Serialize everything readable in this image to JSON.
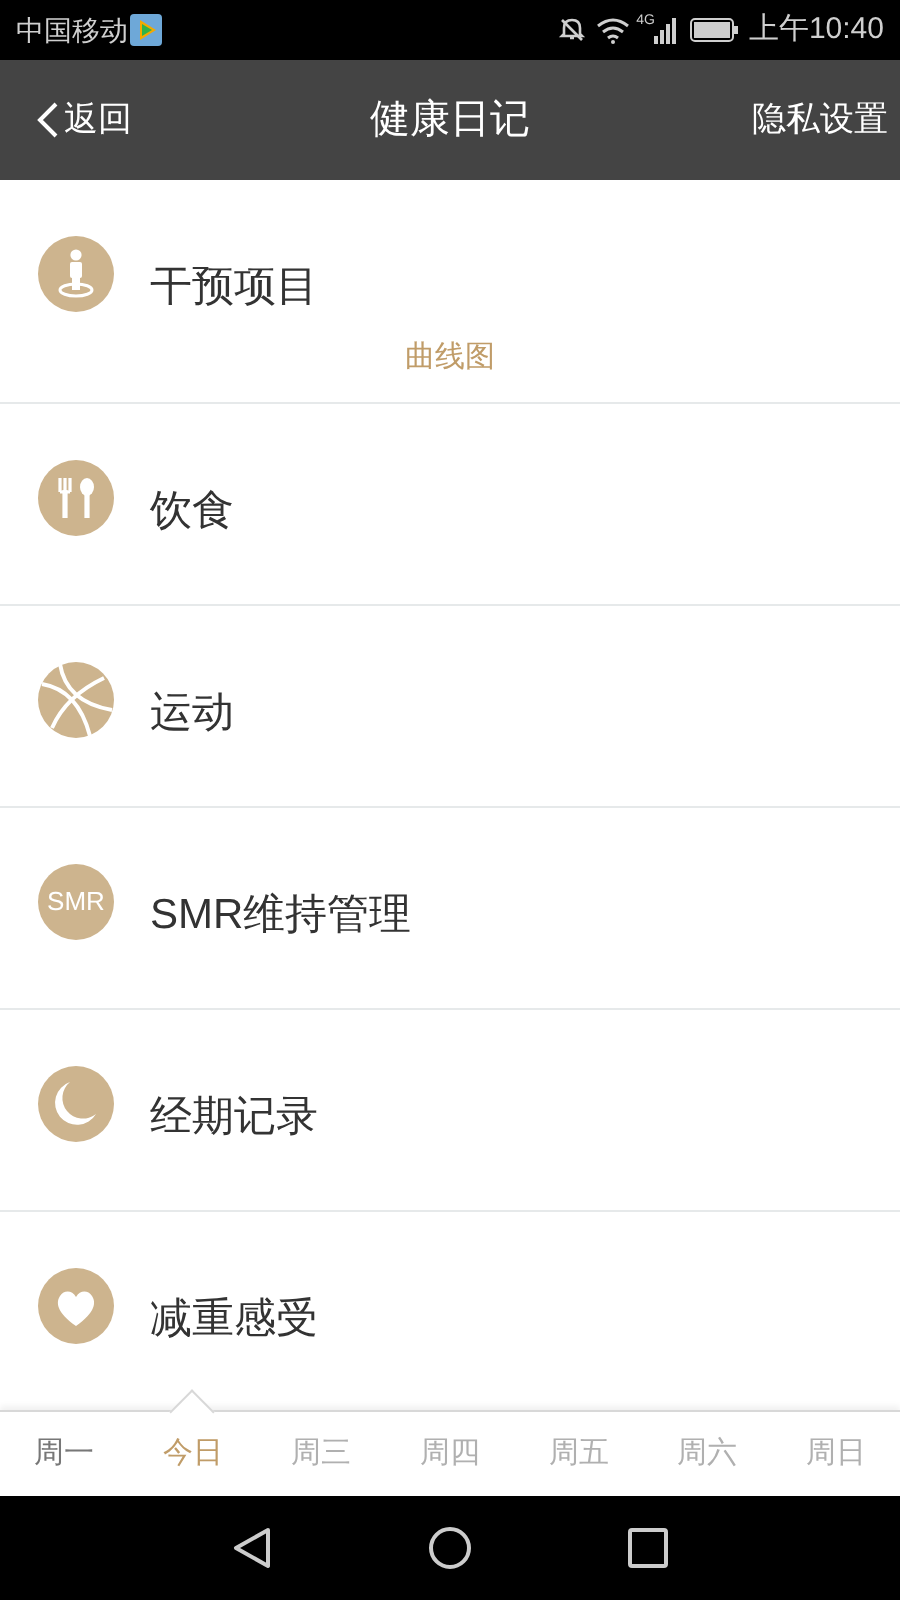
{
  "status_bar": {
    "carrier": "中国移动",
    "network": "4G",
    "time": "上午10:40"
  },
  "header": {
    "back": "返回",
    "title": "健康日记",
    "action": "隐私设置"
  },
  "items": [
    {
      "kind": "person",
      "label": "干预项目",
      "link": "曲线图"
    },
    {
      "kind": "food",
      "label": "饮食"
    },
    {
      "kind": "ball",
      "label": "运动"
    },
    {
      "kind": "badge",
      "badge": "SMR",
      "label": "SMR维持管理"
    },
    {
      "kind": "moon",
      "label": "经期记录"
    },
    {
      "kind": "heart",
      "label": "减重感受"
    }
  ],
  "days": [
    {
      "label": "周一",
      "selected": false,
      "disabled": false
    },
    {
      "label": "今日",
      "selected": true,
      "disabled": false
    },
    {
      "label": "周三",
      "selected": false,
      "disabled": true
    },
    {
      "label": "周四",
      "selected": false,
      "disabled": true
    },
    {
      "label": "周五",
      "selected": false,
      "disabled": true
    },
    {
      "label": "周六",
      "selected": false,
      "disabled": true
    },
    {
      "label": "周日",
      "selected": false,
      "disabled": true
    }
  ]
}
